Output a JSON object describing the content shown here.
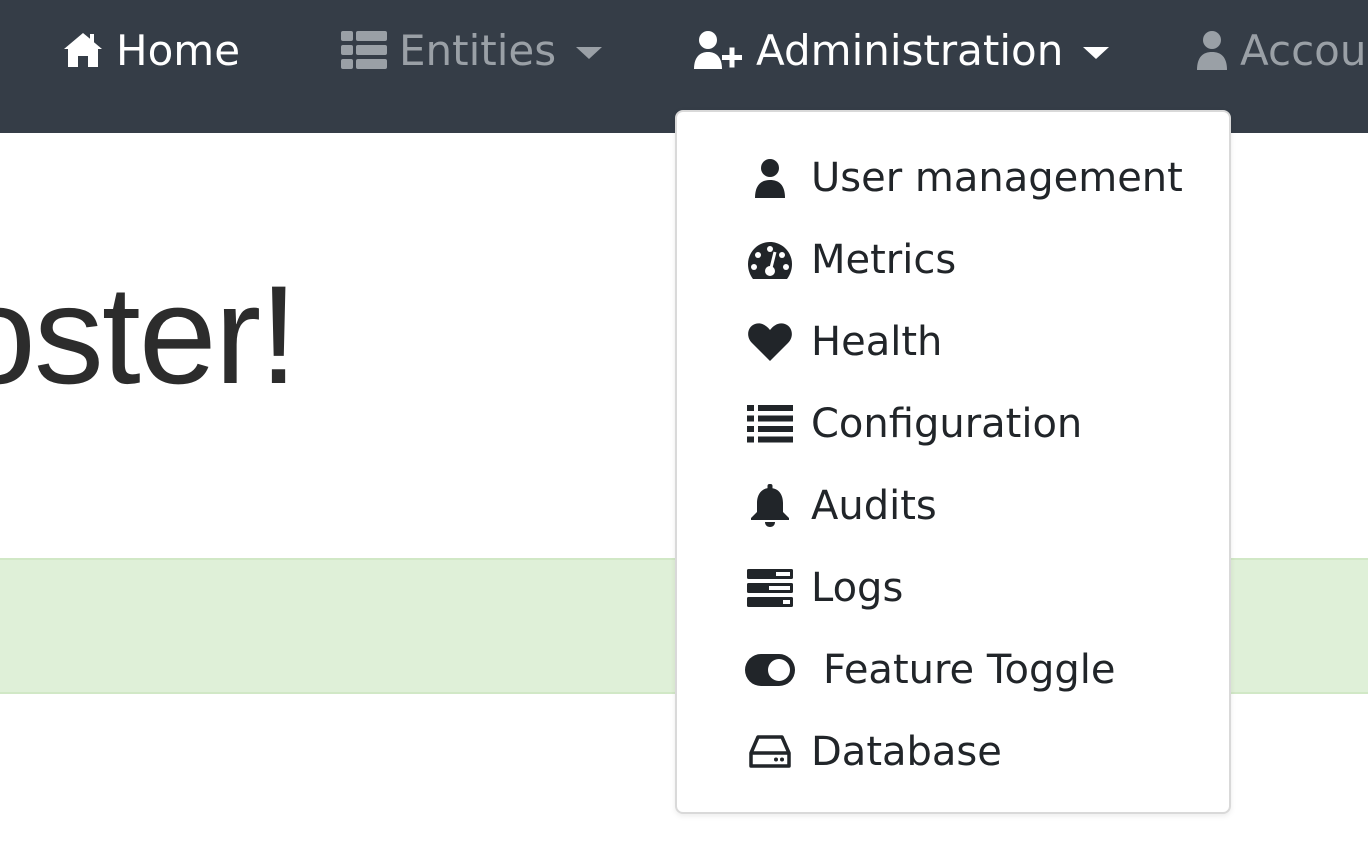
{
  "navbar": {
    "background": "#353d47",
    "items": [
      {
        "label": "Home",
        "icon": "home-icon"
      },
      {
        "label": "Entities",
        "icon": "th-list-icon"
      },
      {
        "label": "Administration",
        "icon": "user-plus-icon"
      },
      {
        "label": "Accou",
        "icon": "user-icon"
      }
    ]
  },
  "hero": {
    "title": "oster!"
  },
  "alert": {
    "background": "#dff0d8"
  },
  "admin_menu": {
    "items": [
      {
        "label": "User management",
        "icon": "user-icon"
      },
      {
        "label": "Metrics",
        "icon": "tachometer-icon"
      },
      {
        "label": "Health",
        "icon": "heart-icon"
      },
      {
        "label": "Configuration",
        "icon": "list-icon"
      },
      {
        "label": "Audits",
        "icon": "bell-icon"
      },
      {
        "label": "Logs",
        "icon": "tasks-icon"
      },
      {
        "label": "Feature Toggle",
        "icon": "toggle-on-icon"
      },
      {
        "label": "Database",
        "icon": "hdd-icon"
      }
    ]
  }
}
